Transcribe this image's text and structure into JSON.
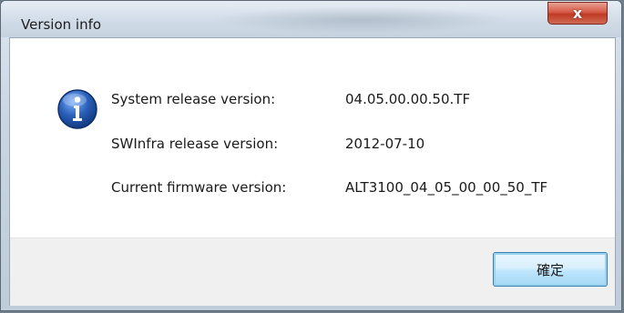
{
  "window": {
    "title": "Version info",
    "close_glyph": "x"
  },
  "info": {
    "icon": "information-icon",
    "rows": [
      {
        "label": "System release version:",
        "value": "04.05.00.00.50.TF"
      },
      {
        "label": "SWInfra release version:",
        "value": "2012-07-10"
      },
      {
        "label": "Current firmware version:",
        "value": "ALT3100_04_05_00_00_50_TF"
      }
    ]
  },
  "buttons": {
    "ok_label": "確定"
  },
  "colors": {
    "close_button": "#c9432f",
    "info_icon_blue": "#2a5fb8",
    "ok_button_border": "#3c7fb1"
  }
}
